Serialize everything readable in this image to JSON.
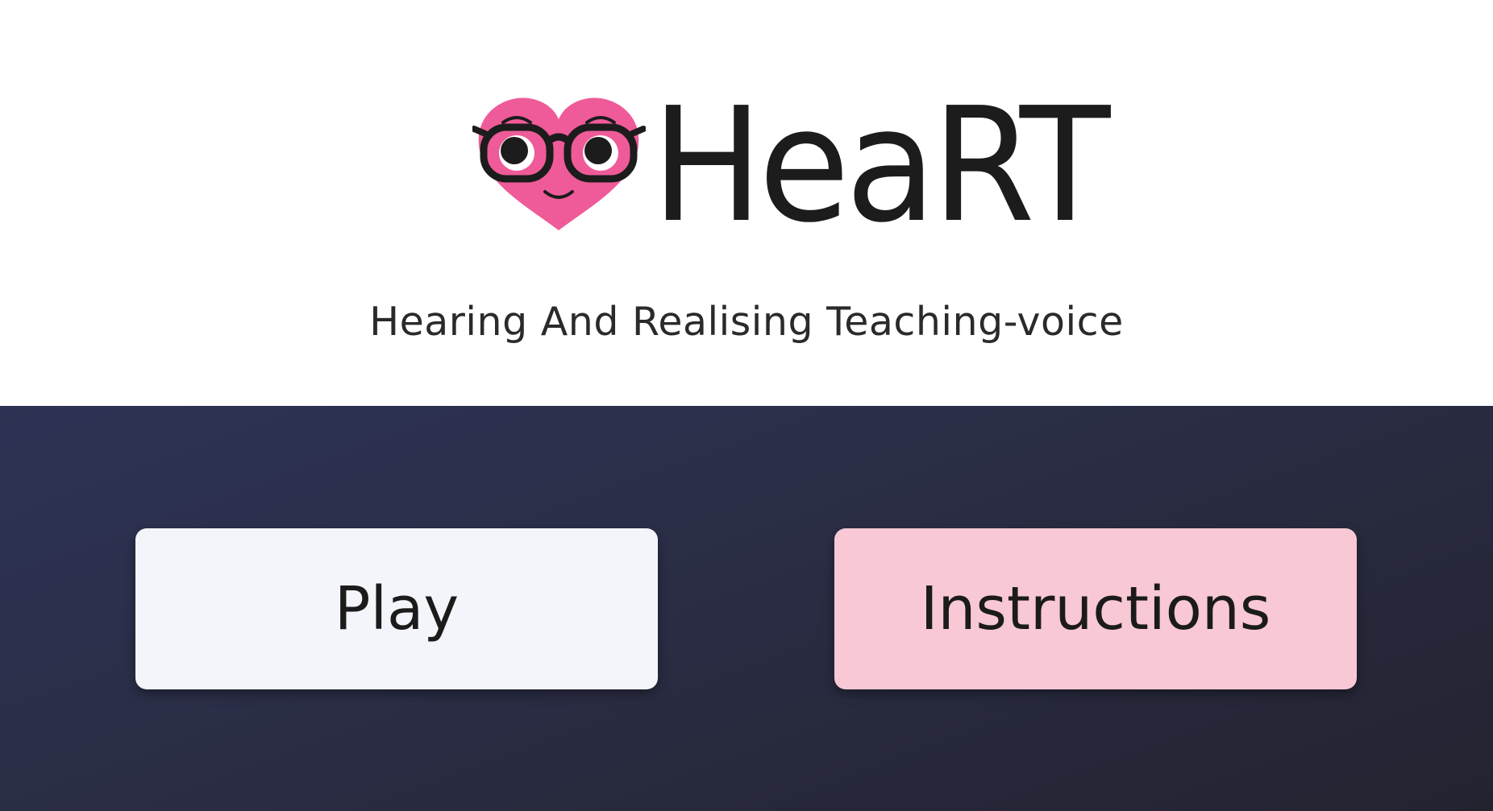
{
  "header": {
    "logo_text": "HeaRT",
    "subtitle": "Hearing And Realising Teaching-voice"
  },
  "logo_icon": "heart-with-glasses-icon",
  "menu": {
    "play_label": "Play",
    "instructions_label": "Instructions"
  },
  "colors": {
    "heart": "#ef5b98",
    "button_play": "#f3f5fa",
    "button_instructions": "#f9c8d5",
    "menu_background": "#2a2d45"
  }
}
